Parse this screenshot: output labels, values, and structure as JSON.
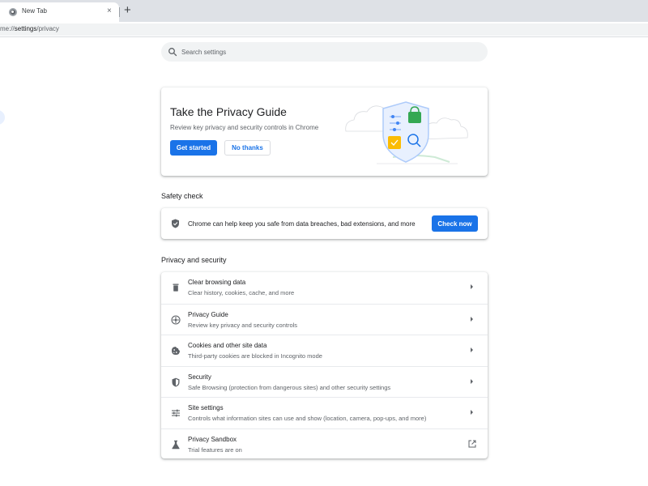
{
  "browser": {
    "tab_title": "New Tab",
    "tab_close": "×",
    "new_tab": "+",
    "url_prefix": "me://",
    "url_path": "settings",
    "url_suffix": "/privacy"
  },
  "search": {
    "placeholder": "Search settings",
    "icon": "search-icon"
  },
  "privacy_guide_promo": {
    "title": "Take the Privacy Guide",
    "description": "Review key privacy and security controls in Chrome",
    "primary_button": "Get started",
    "secondary_button": "No thanks"
  },
  "safety_check": {
    "section_title": "Safety check",
    "text": "Chrome can help keep you safe from data breaches, bad extensions, and more",
    "button": "Check now",
    "icon": "shield-check-icon"
  },
  "privacy_security": {
    "section_title": "Privacy and security",
    "items": [
      {
        "title": "Clear browsing data",
        "subtitle": "Clear history, cookies, cache, and more",
        "icon": "trash-icon",
        "action": "arrow"
      },
      {
        "title": "Privacy Guide",
        "subtitle": "Review key privacy and security controls",
        "icon": "compass-icon",
        "action": "arrow"
      },
      {
        "title": "Cookies and other site data",
        "subtitle": "Third-party cookies are blocked in Incognito mode",
        "icon": "cookie-icon",
        "action": "arrow"
      },
      {
        "title": "Security",
        "subtitle": "Safe Browsing (protection from dangerous sites) and other security settings",
        "icon": "shield-icon",
        "action": "arrow"
      },
      {
        "title": "Site settings",
        "subtitle": "Controls what information sites can use and show (location, camera, pop-ups, and more)",
        "icon": "tune-icon",
        "action": "arrow"
      },
      {
        "title": "Privacy Sandbox",
        "subtitle": "Trial features are on",
        "icon": "flask-icon",
        "action": "external-link"
      }
    ]
  },
  "colors": {
    "accent": "#1a73e8",
    "text_primary": "#202124",
    "text_secondary": "#5f6368",
    "tab_strip": "#dee1e6",
    "search_bg": "#f1f3f4"
  }
}
